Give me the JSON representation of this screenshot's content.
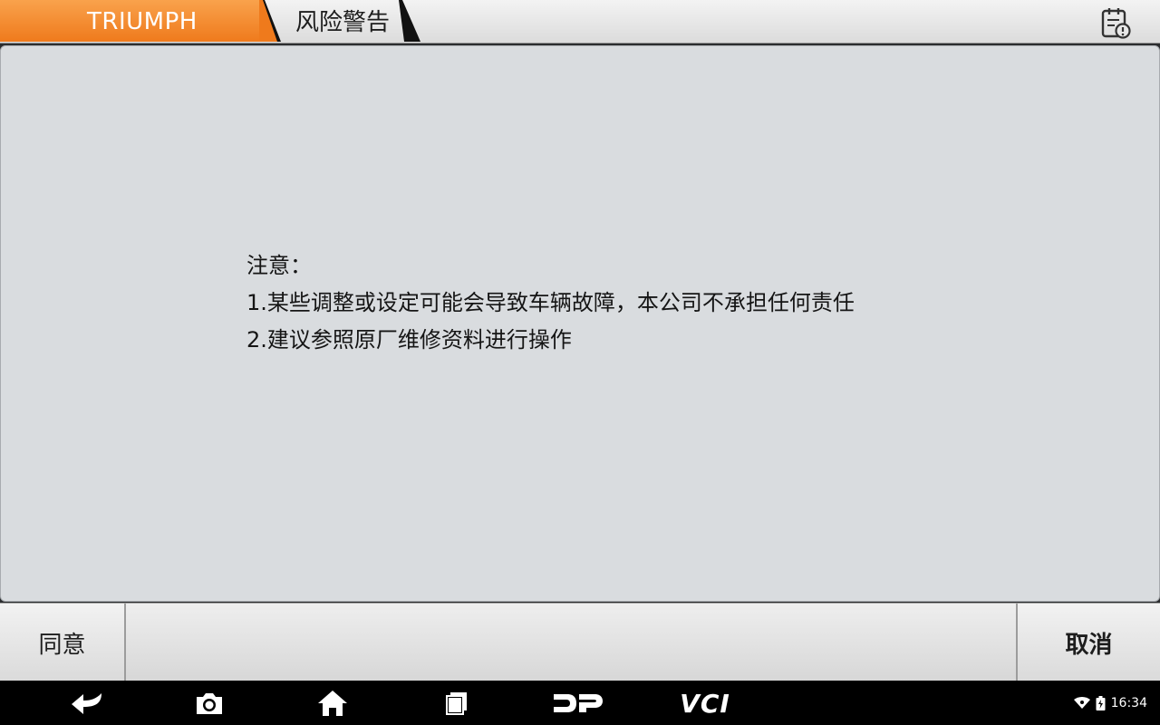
{
  "header": {
    "brand": "TRIUMPH",
    "page_title": "风险警告",
    "report_icon": "calendar-alert-icon"
  },
  "message": {
    "lines": [
      "注意：",
      "1.某些调整或设定可能会导致车辆故障，本公司不承担任何责任",
      "2.建议参照原厂维修资料进行操作"
    ]
  },
  "actions": {
    "agree_label": "同意",
    "cancel_label": "取消"
  },
  "navbar": {
    "icons": [
      "back-icon",
      "camera-icon",
      "home-icon",
      "recent-apps-icon",
      "dp-logo-icon",
      "vci-icon"
    ],
    "vci_label": "VCI",
    "time": "16:34"
  },
  "colors": {
    "brand_orange": "#F08A2C",
    "panel_bg": "#D9DCDF",
    "navbar_bg": "#000000"
  }
}
